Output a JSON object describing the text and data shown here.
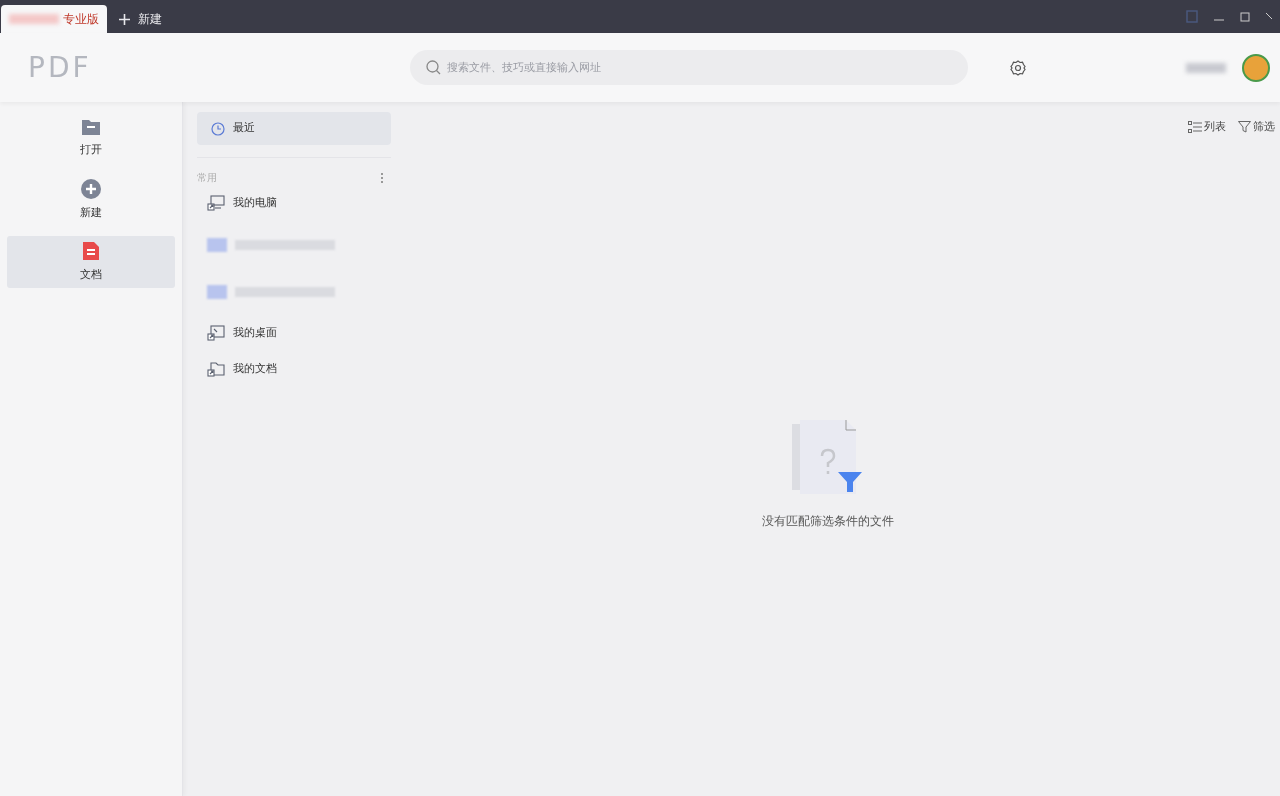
{
  "tabs": [
    {
      "label": "专业版",
      "selected": true
    },
    {
      "label": "新建",
      "kind": "new",
      "selected": false
    }
  ],
  "logo": "PDF",
  "search": {
    "placeholder": "搜索文件、技巧或直接输入网址"
  },
  "nav": [
    {
      "label": "打开",
      "kind": "open",
      "selected": false
    },
    {
      "label": "新建",
      "kind": "new",
      "selected": false
    },
    {
      "label": "文档",
      "kind": "doc",
      "selected": true
    }
  ],
  "recent": {
    "label": "最近",
    "selected": true
  },
  "section_title": "常用",
  "places": [
    {
      "label": "我的电脑",
      "kind": "computer"
    },
    {
      "kind": "hidden"
    },
    {
      "kind": "hidden"
    },
    {
      "label": "我的桌面",
      "kind": "desktop"
    },
    {
      "label": "我的文档",
      "kind": "folder"
    }
  ],
  "toolbar": {
    "list": "列表",
    "filter": "筛选"
  },
  "empty_message": "没有匹配筛选条件的文件"
}
